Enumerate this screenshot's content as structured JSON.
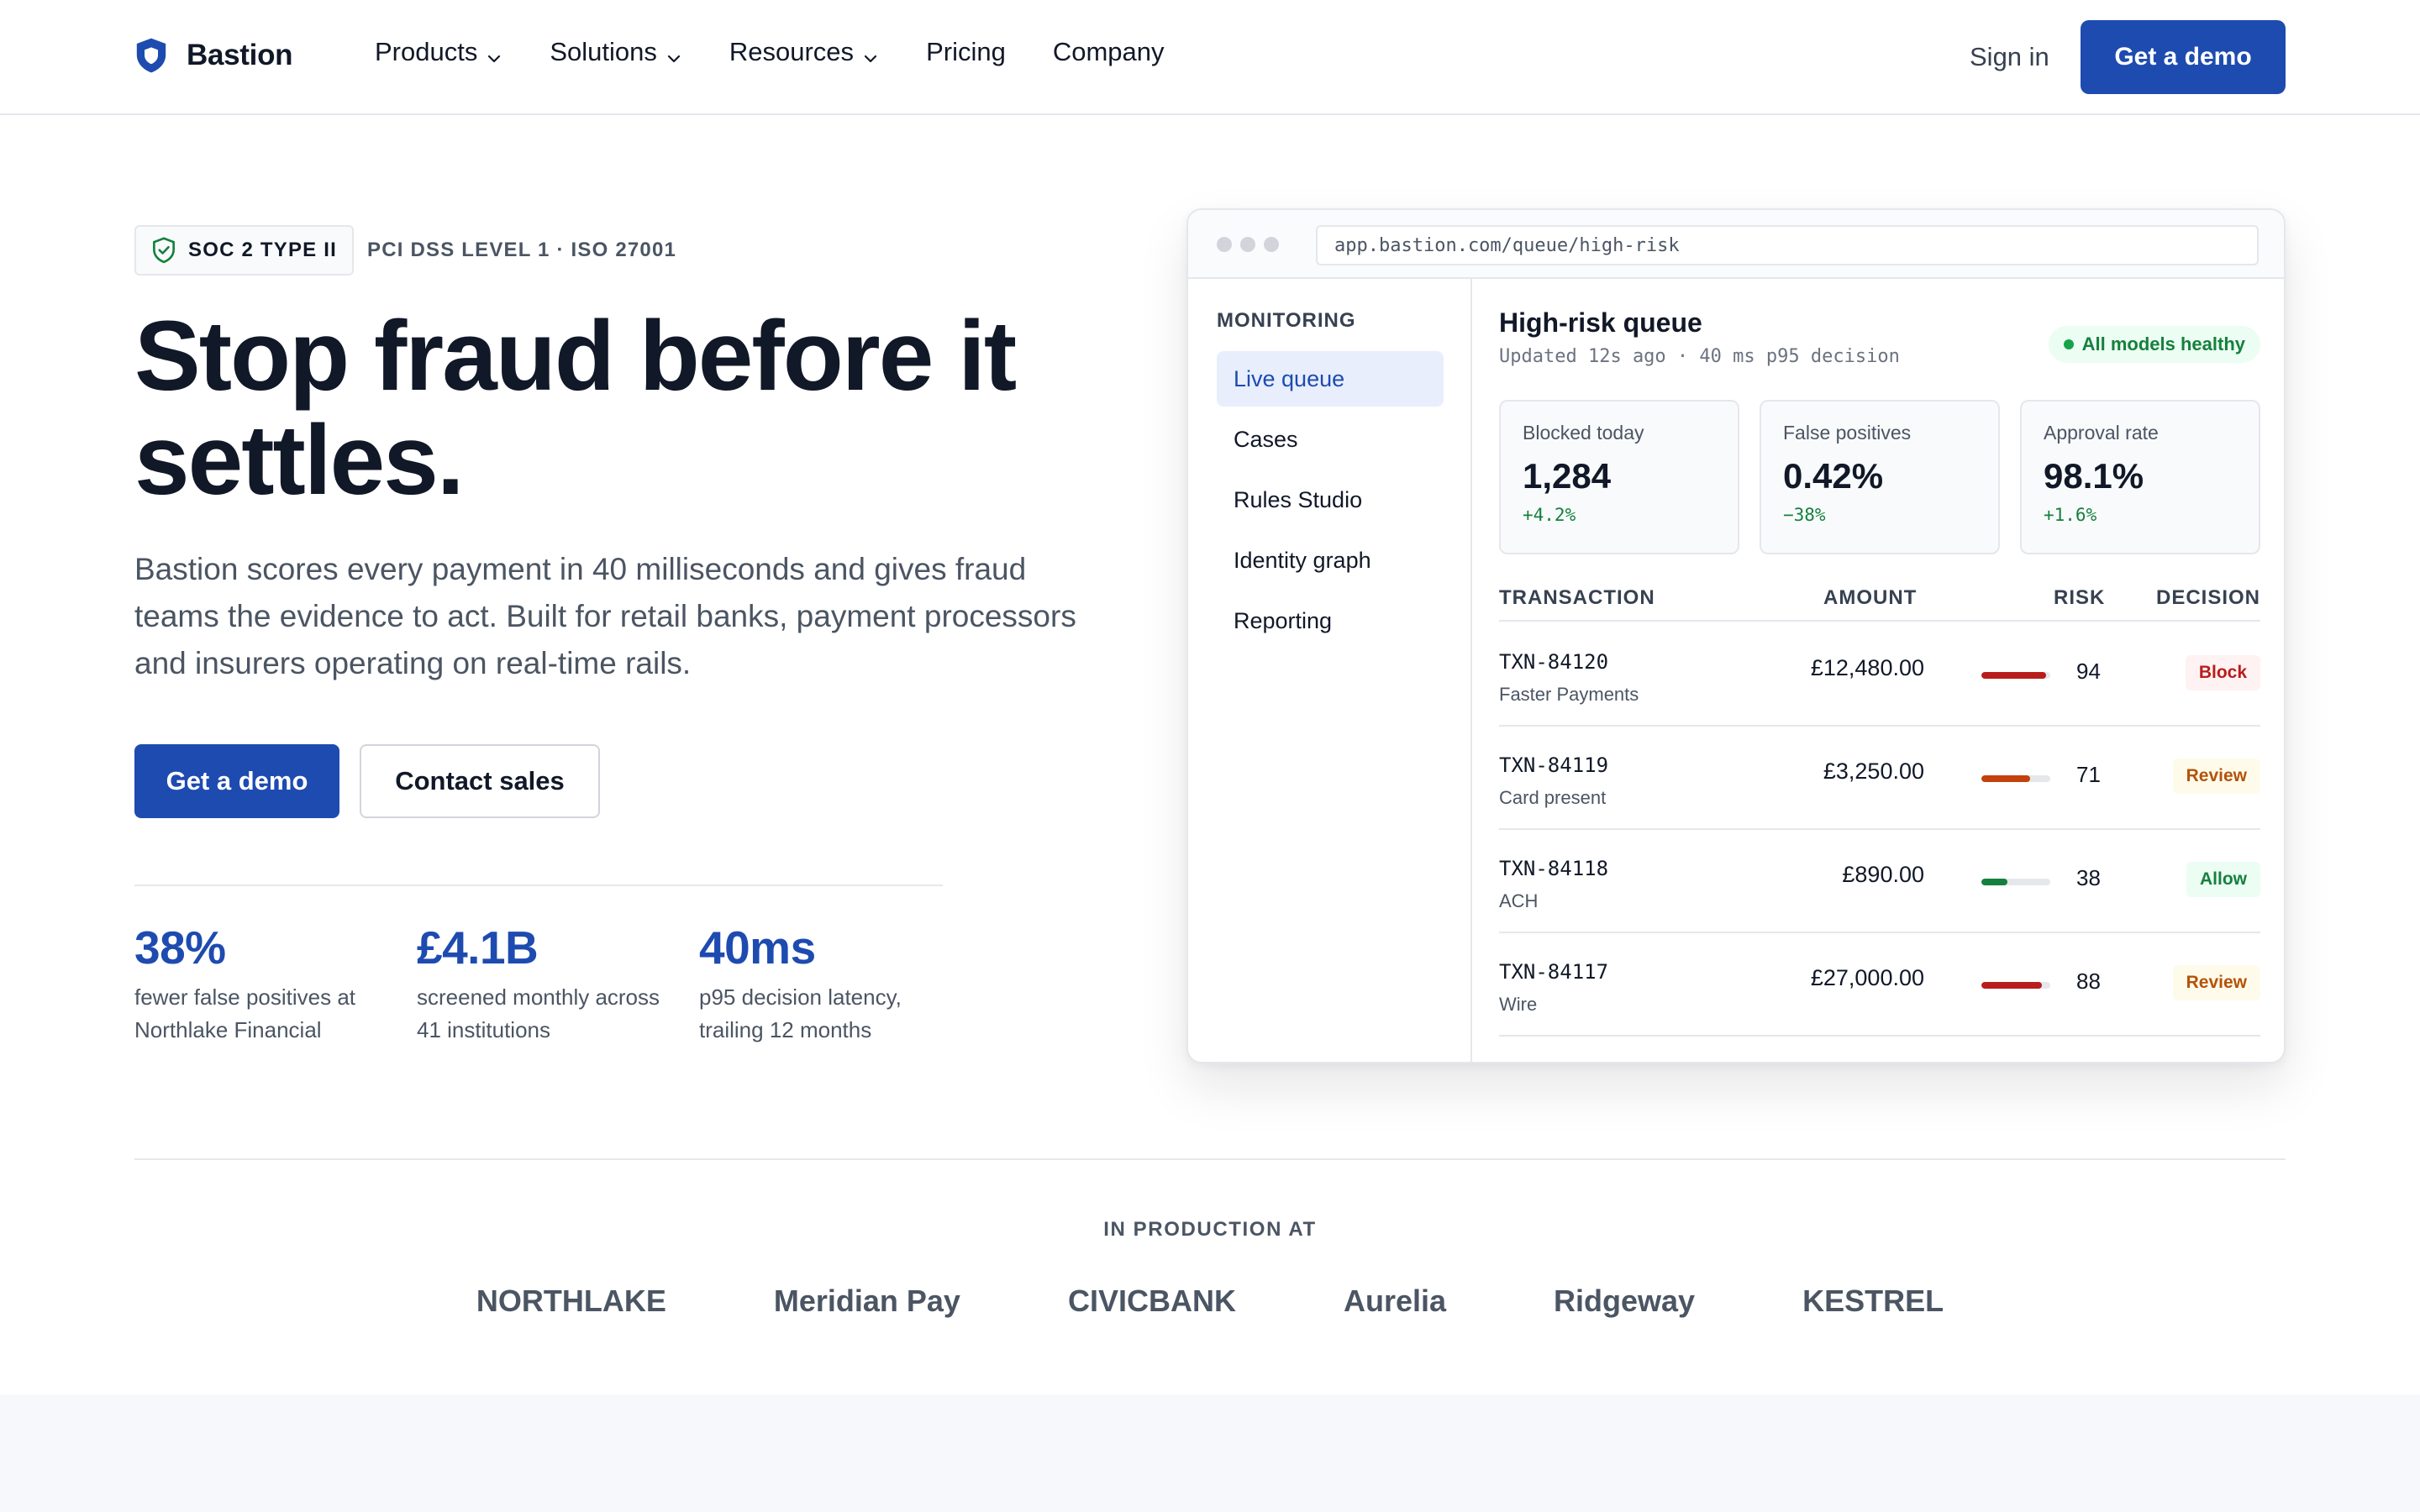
{
  "nav": {
    "brand": "Bastion",
    "links": [
      {
        "label": "Products",
        "dropdown": true
      },
      {
        "label": "Solutions",
        "dropdown": true
      },
      {
        "label": "Resources",
        "dropdown": true
      },
      {
        "label": "Pricing",
        "dropdown": false
      },
      {
        "label": "Company",
        "dropdown": false
      }
    ],
    "sign_in": "Sign in",
    "cta": "Get a demo"
  },
  "hero": {
    "badge_primary": "SOC 2 TYPE II",
    "badge_secondary": "PCI DSS LEVEL 1 · ISO 27001",
    "title": "Stop fraud before it settles.",
    "subtitle": "Bastion scores every payment in 40 milliseconds and gives fraud teams the evidence to act. Built for retail banks, payment processors and insurers operating on real-time rails.",
    "cta_primary": "Get a demo",
    "cta_secondary": "Contact sales",
    "stats": [
      {
        "value": "38%",
        "label": "fewer false positives at Northlake Financial"
      },
      {
        "value": "£4.1B",
        "label": "screened monthly across 41 institutions"
      },
      {
        "value": "40ms",
        "label": "p95 decision latency, trailing 12 months"
      }
    ]
  },
  "app": {
    "url": "app.bastion.com/queue/high-risk",
    "sidebar": {
      "heading": "MONITORING",
      "items": [
        "Live queue",
        "Cases",
        "Rules Studio",
        "Identity graph",
        "Reporting"
      ],
      "active_index": 0
    },
    "queue": {
      "title": "High-risk queue",
      "subtitle": "Updated 12s ago · 40 ms p95 decision",
      "status": "All models healthy",
      "kpis": [
        {
          "label": "Blocked today",
          "value": "1,284",
          "delta": "+4.2%"
        },
        {
          "label": "False positives",
          "value": "0.42%",
          "delta": "−38%"
        },
        {
          "label": "Approval rate",
          "value": "98.1%",
          "delta": "+1.6%"
        }
      ],
      "columns": [
        "TRANSACTION",
        "AMOUNT",
        "RISK",
        "DECISION"
      ],
      "rows": [
        {
          "id": "TXN-84120",
          "type": "Faster Payments",
          "amount": "£12,480.00",
          "risk": "94",
          "risk_color": "#b91c1c",
          "decision": "Block",
          "decision_kind": "block"
        },
        {
          "id": "TXN-84119",
          "type": "Card present",
          "amount": "£3,250.00",
          "risk": "71",
          "risk_color": "#c2410c",
          "decision": "Review",
          "decision_kind": "review"
        },
        {
          "id": "TXN-84118",
          "type": "ACH",
          "amount": "£890.00",
          "risk": "38",
          "risk_color": "#15803d",
          "decision": "Allow",
          "decision_kind": "allow"
        },
        {
          "id": "TXN-84117",
          "type": "Wire",
          "amount": "£27,000.00",
          "risk": "88",
          "risk_color": "#b91c1c",
          "decision": "Review",
          "decision_kind": "review"
        }
      ]
    }
  },
  "customers": {
    "label": "IN PRODUCTION AT",
    "logos": [
      "NORTHLAKE",
      "Meridian Pay",
      "CIVICBANK",
      "Aurelia",
      "Ridgeway",
      "KESTREL"
    ]
  },
  "colors": {
    "brand": "#1e4bb0",
    "text": "#111827",
    "muted": "#4b5563",
    "success": "#15803d",
    "danger": "#b91c1c",
    "warning": "#b45309"
  }
}
